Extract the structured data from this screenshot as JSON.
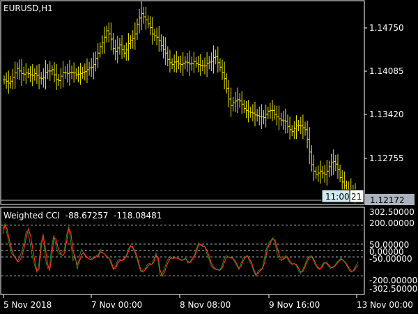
{
  "main_chart": {
    "title": "EURUSD,H1",
    "price_ticks": [
      "1.14750",
      "1.14085",
      "1.13420",
      "1.12755"
    ],
    "current_price": "1.12172",
    "crosshair_label": "11:00",
    "crosshair_label2": "21",
    "colors": {
      "background": "#000000",
      "frame": "#ffffff",
      "bars": "#f0e400",
      "current_price_box": "#a9b3bd"
    }
  },
  "indicator": {
    "title": "Weighted CCI",
    "value1": "-88.67257",
    "value2": "-118.08481",
    "level_labels": [
      "302.50000",
      "200.00000",
      "50.00000",
      "0.00000",
      "-50.00000",
      "-200.00000",
      "-302.50000"
    ],
    "colors": {
      "series1": "#1f8c1f",
      "series2": "#ff2a1a",
      "level_lines": "#c8c8c8"
    }
  },
  "time_axis": {
    "labels": [
      "5 Nov 2018",
      "7 Nov 00:00",
      "8 Nov 08:00",
      "9 Nov 16:00",
      "13 Nov 00:00"
    ]
  },
  "chart_data": [
    {
      "type": "ohlc",
      "title": "EURUSD,H1",
      "ylim": [
        1.1205,
        1.152
      ],
      "y_ticks": [
        1.1475,
        1.14085,
        1.1342,
        1.12755
      ],
      "current_price": 1.12172,
      "close_series": [
        1.1398,
        1.1396,
        1.1393,
        1.1396,
        1.1402,
        1.1409,
        1.1416,
        1.1412,
        1.1408,
        1.1407,
        1.1409,
        1.1408,
        1.1406,
        1.1405,
        1.1408,
        1.1405,
        1.1401,
        1.14,
        1.1402,
        1.141,
        1.1412,
        1.1412,
        1.1414,
        1.1406,
        1.1399,
        1.1397,
        1.1404,
        1.141,
        1.1409,
        1.1408,
        1.141,
        1.141,
        1.1409,
        1.1406,
        1.1407,
        1.1408,
        1.141,
        1.1411,
        1.1414,
        1.1417,
        1.1418,
        1.1422,
        1.1432,
        1.144,
        1.145,
        1.1456,
        1.1465,
        1.1475,
        1.147,
        1.1462,
        1.1447,
        1.1443,
        1.1448,
        1.1453,
        1.1446,
        1.144,
        1.1445,
        1.1455,
        1.146,
        1.1463,
        1.147,
        1.1485,
        1.1495,
        1.1502,
        1.1497,
        1.1492,
        1.1486,
        1.148,
        1.147,
        1.1467,
        1.1465,
        1.146,
        1.1452,
        1.1446,
        1.144,
        1.143,
        1.1425,
        1.1422,
        1.1426,
        1.1427,
        1.1423,
        1.1422,
        1.1424,
        1.1426,
        1.1425,
        1.1423,
        1.1424,
        1.1427,
        1.1424,
        1.1422,
        1.1421,
        1.142,
        1.142,
        1.1424,
        1.1426,
        1.1427,
        1.1433,
        1.1435,
        1.1425,
        1.1418,
        1.141,
        1.14,
        1.1385,
        1.1368,
        1.1358,
        1.1362,
        1.1365,
        1.1367,
        1.1365,
        1.136,
        1.1353,
        1.135,
        1.1348,
        1.1347,
        1.1346,
        1.1343,
        1.1342,
        1.1341,
        1.134,
        1.1339,
        1.1344,
        1.1349,
        1.135,
        1.135,
        1.1344,
        1.134,
        1.1337,
        1.1335,
        1.1334,
        1.1333,
        1.1325,
        1.132,
        1.1317,
        1.1322,
        1.1326,
        1.1327,
        1.1326,
        1.1323,
        1.132,
        1.1305,
        1.1285,
        1.1265,
        1.1255,
        1.125,
        1.1252,
        1.1255,
        1.1252,
        1.125,
        1.1255,
        1.1262,
        1.1268,
        1.127,
        1.1266,
        1.1258,
        1.1245,
        1.1238,
        1.1232,
        1.1226,
        1.1226,
        1.1224,
        1.1222,
        1.1219
      ]
    },
    {
      "type": "line",
      "title": "Weighted CCI",
      "ylim": [
        -302.5,
        302.5
      ],
      "levels": [
        200,
        50,
        0,
        -50,
        -200
      ],
      "series": [
        {
          "values": [
            170,
            210,
            130,
            50,
            -20,
            -40,
            -60,
            -80,
            -50,
            0,
            60,
            150,
            140,
            40,
            -60,
            -120,
            -170,
            -100,
            60,
            130,
            -60,
            -140,
            -130,
            40,
            120,
            40,
            -20,
            -30,
            -10,
            10,
            120,
            190,
            60,
            -80,
            -40,
            -150,
            -50,
            10,
            -20,
            -50,
            -60,
            -70,
            -60,
            -55,
            -40,
            -30,
            10,
            -20,
            -30,
            -60,
            -60,
            -110,
            -150,
            -120,
            -80,
            -70,
            -80,
            -60,
            -40,
            10,
            40,
            20,
            -10,
            -60,
            -120,
            -170,
            -150,
            -140,
            -110,
            -100,
            -110,
            -70,
            -20,
            -80,
            -200,
            -180,
            -140,
            -90,
            -60,
            -50,
            -65,
            -55,
            -60,
            -70,
            -80,
            -70,
            -60,
            -100,
            -90,
            -60,
            -40,
            10,
            60,
            40,
            30,
            30,
            -30,
            -70,
            -120,
            -140,
            -150,
            -150,
            -160,
            -120,
            -70,
            -40,
            -50,
            -60,
            -60,
            -90,
            -120,
            -150,
            -100,
            -60,
            -50,
            -40,
            -90,
            -110,
            -170,
            -200,
            -160,
            -150,
            -140,
            -60,
            20,
            60,
            80,
            100,
            60,
            -30,
            -70,
            -80,
            -60,
            -40,
            -70,
            -100,
            -110,
            -100,
            -120,
            -160,
            -180,
            -150,
            -110,
            -70,
            -50,
            -40,
            -80,
            -120,
            -140,
            -150,
            -120,
            -90,
            -100,
            -120,
            -140,
            -130,
            -120,
            -90,
            -80,
            -60,
            -80,
            -100,
            -130,
            -160,
            -170,
            -150,
            -120,
            -88.67257
          ]
        },
        {
          "values": [
            130,
            200,
            170,
            90,
            20,
            -30,
            -60,
            -90,
            -80,
            -40,
            20,
            100,
            170,
            120,
            20,
            -80,
            -160,
            -150,
            20,
            120,
            20,
            -100,
            -160,
            -50,
            100,
            90,
            20,
            -20,
            -40,
            -20,
            70,
            170,
            140,
            0,
            -60,
            -110,
            -90,
            -30,
            -20,
            -40,
            -60,
            -70,
            -70,
            -60,
            -50,
            -40,
            -10,
            -20,
            -30,
            -50,
            -60,
            -90,
            -140,
            -140,
            -100,
            -80,
            -80,
            -70,
            -50,
            -10,
            30,
            30,
            0,
            -40,
            -100,
            -160,
            -170,
            -150,
            -130,
            -110,
            -110,
            -90,
            -40,
            -50,
            -160,
            -200,
            -170,
            -120,
            -80,
            -60,
            -60,
            -60,
            -60,
            -65,
            -75,
            -75,
            -65,
            -85,
            -95,
            -75,
            -50,
            -10,
            40,
            50,
            35,
            30,
            0,
            -50,
            -100,
            -130,
            -145,
            -150,
            -155,
            -140,
            -100,
            -60,
            -50,
            -55,
            -60,
            -75,
            -105,
            -140,
            -125,
            -80,
            -55,
            -45,
            -70,
            -100,
            -150,
            -190,
            -180,
            -160,
            -145,
            -100,
            -20,
            40,
            70,
            90,
            80,
            20,
            -40,
            -70,
            -70,
            -50,
            -55,
            -85,
            -105,
            -105,
            -110,
            -140,
            -170,
            -165,
            -130,
            -90,
            -60,
            -50,
            -65,
            -100,
            -130,
            -145,
            -135,
            -105,
            -95,
            -110,
            -130,
            -135,
            -125,
            -105,
            -85,
            -70,
            -75,
            -95,
            -115,
            -145,
            -165,
            -160,
            -135,
            -118.08481
          ]
        }
      ]
    }
  ]
}
